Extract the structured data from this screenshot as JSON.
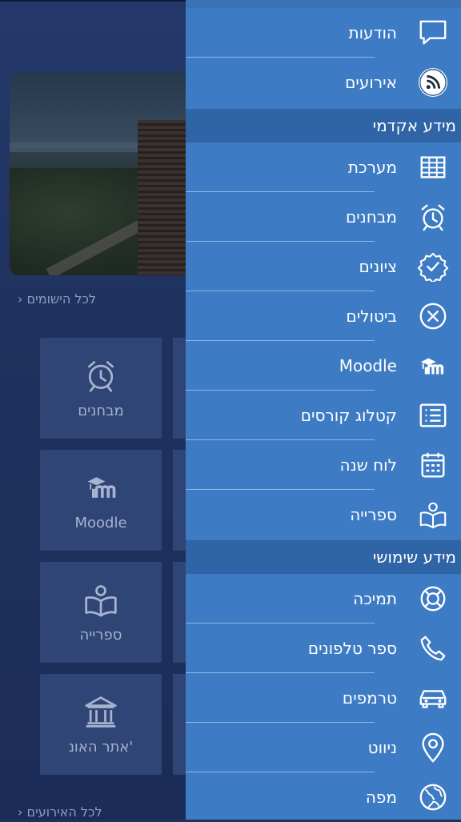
{
  "background": {
    "news_more_link": "לכל הישומים",
    "events_more_link": "לכל האירועים",
    "tiles": [
      {
        "label": "מבחנים",
        "icon": "alarm-clock-icon"
      },
      {
        "label": "Moodle",
        "icon": "moodle-icon"
      },
      {
        "label": "ספרייה",
        "icon": "library-icon"
      },
      {
        "label": "אתר האונ'",
        "icon": "university-building-icon"
      }
    ]
  },
  "drawer": {
    "top_items": [
      {
        "label": "הודעות",
        "icon": "chat-bubble-icon"
      },
      {
        "label": "אירועים",
        "icon": "rss-icon"
      }
    ],
    "section_academic": "מידע אקדמי",
    "academic_items": [
      {
        "label": "מערכת",
        "icon": "timetable-grid-icon"
      },
      {
        "label": "מבחנים",
        "icon": "alarm-clock-icon"
      },
      {
        "label": "ציונים",
        "icon": "badge-check-icon"
      },
      {
        "label": "ביטולים",
        "icon": "cancel-circle-icon"
      },
      {
        "label": "Moodle",
        "icon": "moodle-icon"
      },
      {
        "label": "קטלוג קורסים",
        "icon": "list-icon"
      },
      {
        "label": "לוח שנה",
        "icon": "calendar-icon"
      },
      {
        "label": "ספרייה",
        "icon": "library-icon"
      }
    ],
    "section_useful": "מידע שימושי",
    "useful_items": [
      {
        "label": "תמיכה",
        "icon": "lifebuoy-icon"
      },
      {
        "label": "ספר טלפונים",
        "icon": "phone-icon"
      },
      {
        "label": "טרמפים",
        "icon": "car-icon"
      },
      {
        "label": "ניווט",
        "icon": "location-pin-icon"
      },
      {
        "label": "מפה",
        "icon": "globe-icon"
      }
    ]
  }
}
